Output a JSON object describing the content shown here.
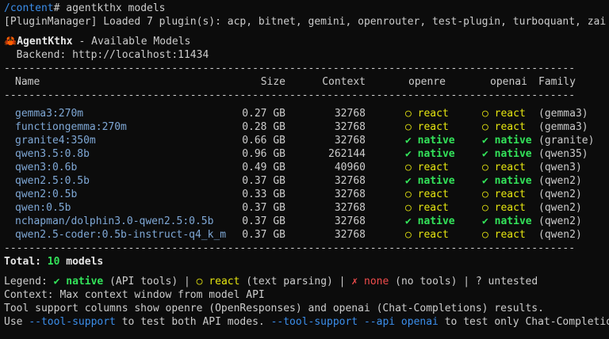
{
  "prompt": {
    "path": "/content",
    "symbol": "#",
    "command": " agentkthx models"
  },
  "plugin_line": "[PluginManager] Loaded 7 plugin(s): acp, bitnet, gemini, openrouter, test-plugin, turboquant, zai",
  "app": {
    "icon": "🦀",
    "name": "AgentKthx",
    "subtitle": " - Available Models",
    "backend_line": "  Backend: http://localhost:11434"
  },
  "separator": "--------------------------------------------------------------------------------------------",
  "columns": {
    "name": "Name",
    "size": "Size",
    "context": "Context",
    "openre": "openre",
    "openai": "openai",
    "family": "Family"
  },
  "models": [
    {
      "name": "gemma3:270m",
      "size": "0.27 GB",
      "context": "32768",
      "openre_icon": "○",
      "openre": "react",
      "openre_status": "react",
      "openai_icon": "○",
      "openai": "react",
      "openai_status": "react",
      "family": "(gemma3)"
    },
    {
      "name": "functiongemma:270m",
      "size": "0.28 GB",
      "context": "32768",
      "openre_icon": "○",
      "openre": "react",
      "openre_status": "react",
      "openai_icon": "○",
      "openai": "react",
      "openai_status": "react",
      "family": "(gemma3)"
    },
    {
      "name": "granite4:350m",
      "size": "0.66 GB",
      "context": "32768",
      "openre_icon": "✔",
      "openre": "native",
      "openre_status": "native",
      "openai_icon": "✔",
      "openai": "native",
      "openai_status": "native",
      "family": "(granite)"
    },
    {
      "name": "qwen3.5:0.8b",
      "size": "0.96 GB",
      "context": "262144",
      "openre_icon": "✔",
      "openre": "native",
      "openre_status": "native",
      "openai_icon": "✔",
      "openai": "native",
      "openai_status": "native",
      "family": "(qwen35)"
    },
    {
      "name": "qwen3:0.6b",
      "size": "0.49 GB",
      "context": "40960",
      "openre_icon": "○",
      "openre": "react",
      "openre_status": "react",
      "openai_icon": "○",
      "openai": "react",
      "openai_status": "react",
      "family": "(qwen3)"
    },
    {
      "name": "qwen2.5:0.5b",
      "size": "0.37 GB",
      "context": "32768",
      "openre_icon": "✔",
      "openre": "native",
      "openre_status": "native",
      "openai_icon": "✔",
      "openai": "native",
      "openai_status": "native",
      "family": "(qwen2)"
    },
    {
      "name": "qwen2:0.5b",
      "size": "0.33 GB",
      "context": "32768",
      "openre_icon": "○",
      "openre": "react",
      "openre_status": "react",
      "openai_icon": "○",
      "openai": "react",
      "openai_status": "react",
      "family": "(qwen2)"
    },
    {
      "name": "qwen:0.5b",
      "size": "0.37 GB",
      "context": "32768",
      "openre_icon": "○",
      "openre": "react",
      "openre_status": "react",
      "openai_icon": "○",
      "openai": "react",
      "openai_status": "react",
      "family": "(qwen2)"
    },
    {
      "name": "nchapman/dolphin3.0-qwen2.5:0.5b",
      "size": "0.37 GB",
      "context": "32768",
      "openre_icon": "✔",
      "openre": "native",
      "openre_status": "native",
      "openai_icon": "✔",
      "openai": "native",
      "openai_status": "native",
      "family": "(qwen2)"
    },
    {
      "name": "qwen2.5-coder:0.5b-instruct-q4_k_m",
      "size": "0.37 GB",
      "context": "32768",
      "openre_icon": "○",
      "openre": "react",
      "openre_status": "react",
      "openai_icon": "○",
      "openai": "react",
      "openai_status": "react",
      "family": "(qwen2)"
    }
  ],
  "total": {
    "label": "Total: ",
    "count": "10",
    "suffix": " models"
  },
  "legend": {
    "label": "Legend: ",
    "native_icon": "✔",
    "native": "native",
    "native_desc": " (API tools) | ",
    "react_icon": "○",
    "react": "react",
    "react_desc": " (text parsing) | ",
    "none_icon": "✗",
    "none": "none",
    "none_desc": " (no tools) | ? untested"
  },
  "context_note": "Context: Max context window from model API",
  "support_note": "Tool support columns show openre (OpenResponses) and openai (Chat-Completions) results.",
  "usage": {
    "pre": "Use ",
    "flag1": "--tool-support",
    "mid": " to test both API modes. ",
    "flag2": "--tool-support --api openai",
    "post": " to test only Chat-Completions."
  },
  "colors": {
    "background": "#0c0c0c",
    "text": "#cccccc",
    "path": "#3b8eea",
    "native": "#33e35a",
    "react": "#e5e510",
    "none": "#f14c4c"
  }
}
